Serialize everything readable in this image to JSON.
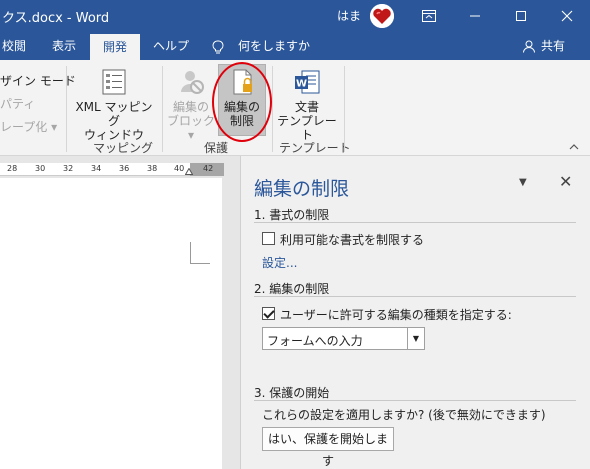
{
  "titlebar": {
    "title": "クス.docx  -  Word",
    "user_name": "はま"
  },
  "tabs": [
    "校閲",
    "表示",
    "開発",
    "ヘルプ",
    "何をしますか",
    "共有"
  ],
  "active_tab": "開発",
  "ribbon": {
    "left_items": [
      "ザイン モード",
      "パティ",
      "レープ化 ▾"
    ],
    "xml_mapping_label": "XML マッピング\nウィンドウ",
    "mapping_group": "マッピング",
    "block_authors_label": "編集の\nブロック ▾",
    "restrict_editing_label": "編集の\n制限",
    "protect_group": "保護",
    "doc_template_label": "文書\nテンプレート",
    "template_group": "テンプレート"
  },
  "ruler": {
    "ticks": [
      "28",
      "30",
      "32",
      "34",
      "36",
      "38",
      "40",
      "42"
    ]
  },
  "pane": {
    "title": "編集の制限",
    "section1": "1. 書式の制限",
    "format_checkbox": "利用可能な書式を制限する",
    "format_checked": false,
    "settings_link": "設定...",
    "section2": "2. 編集の制限",
    "edit_checkbox": "ユーザーに許可する編集の種類を指定する:",
    "edit_checked": true,
    "edit_type_selected": "フォームへの入力",
    "section3": "3. 保護の開始",
    "apply_question": "これらの設定を適用しますか? (後で無効にできます)",
    "start_button": "はい、保護を開始します"
  },
  "colors": {
    "accent": "#2b579a",
    "highlight": "#e0000b"
  }
}
